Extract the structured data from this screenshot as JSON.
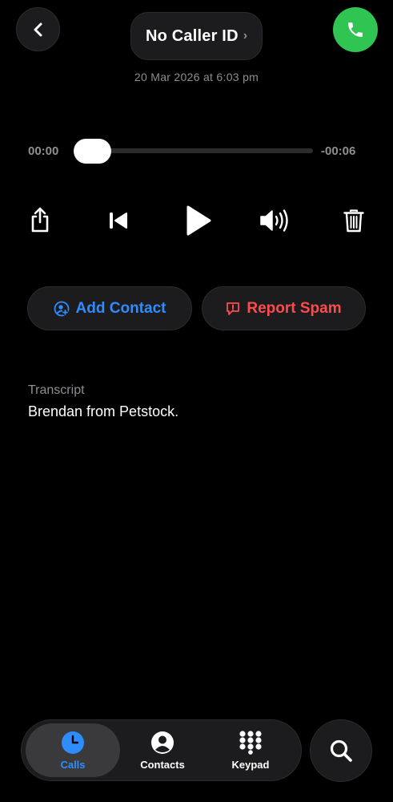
{
  "header": {
    "caller_name": "No Caller ID",
    "chevron": "›",
    "datetime": "20 Mar 2026 at 6:03 pm",
    "back_icon": "chevron-left-icon",
    "call_icon": "phone-icon",
    "accent_call_color": "#30c552"
  },
  "player": {
    "elapsed": "00:00",
    "remaining": "-00:06",
    "progress": 0.0
  },
  "controls": {
    "share_icon": "share-icon",
    "rewind_icon": "skip-back-icon",
    "play_icon": "play-icon",
    "volume_icon": "speaker-icon",
    "delete_icon": "trash-icon"
  },
  "actions": {
    "add_contact_label": "Add Contact",
    "report_spam_label": "Report Spam",
    "add_contact_color": "#2f8cff",
    "report_spam_color": "#ff4b4b"
  },
  "transcript": {
    "label": "Transcript",
    "text": "Brendan from Petstock."
  },
  "tabs": [
    {
      "label": "Calls",
      "icon": "clock-icon",
      "active": true
    },
    {
      "label": "Contacts",
      "icon": "person-icon",
      "active": false
    },
    {
      "label": "Keypad",
      "icon": "keypad-icon",
      "active": false
    }
  ],
  "search_icon": "search-icon"
}
